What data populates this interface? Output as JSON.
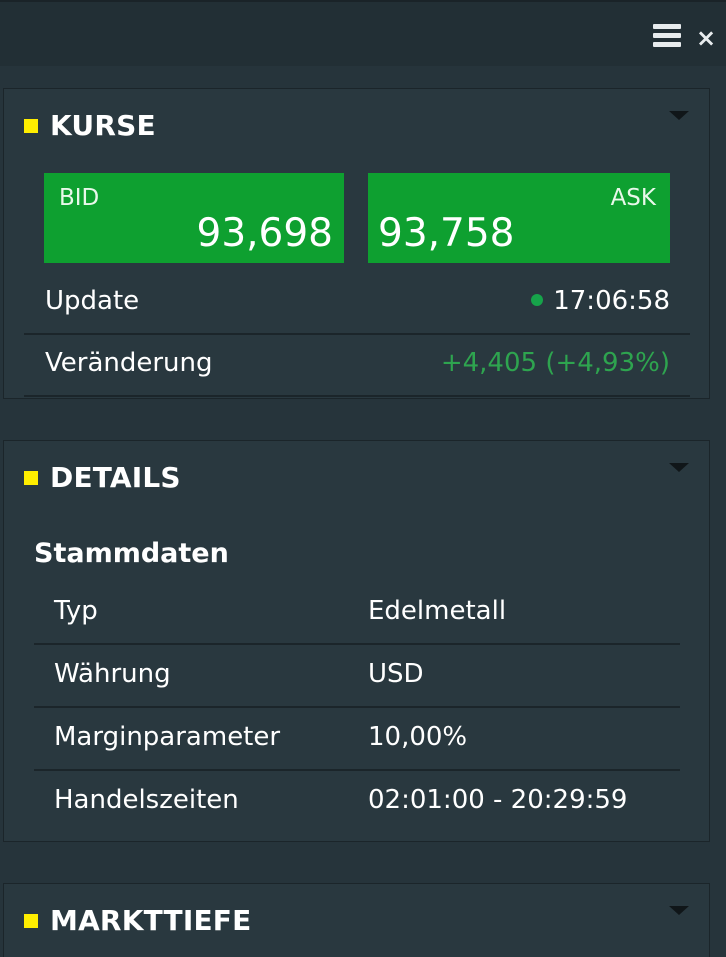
{
  "header": {
    "menu_icon": "hamburger-menu-icon",
    "close_icon": "close-icon",
    "close_glyph": "×"
  },
  "kurse": {
    "title": "KURSE",
    "bid": {
      "label": "BID",
      "value": "93,698"
    },
    "ask": {
      "label": "ASK",
      "value": "93,758"
    },
    "update": {
      "label": "Update",
      "value": "17:06:58"
    },
    "change": {
      "label": "Veränderung",
      "value": "+4,405 (+4,93%)"
    }
  },
  "details": {
    "title": "DETAILS",
    "subheading": "Stammdaten",
    "rows": [
      {
        "label": "Typ",
        "value": "Edelmetall"
      },
      {
        "label": "Währung",
        "value": "USD"
      },
      {
        "label": "Marginparameter",
        "value": "10,00%"
      },
      {
        "label": "Handelszeiten",
        "value": "02:01:00 - 20:29:59"
      }
    ]
  },
  "markttiefe": {
    "title": "MARKTTIEFE"
  },
  "colors": {
    "accent_square": "#ffee00",
    "quote_green": "#0ea030",
    "positive_change": "#2ea44f",
    "background": "#26343b"
  }
}
